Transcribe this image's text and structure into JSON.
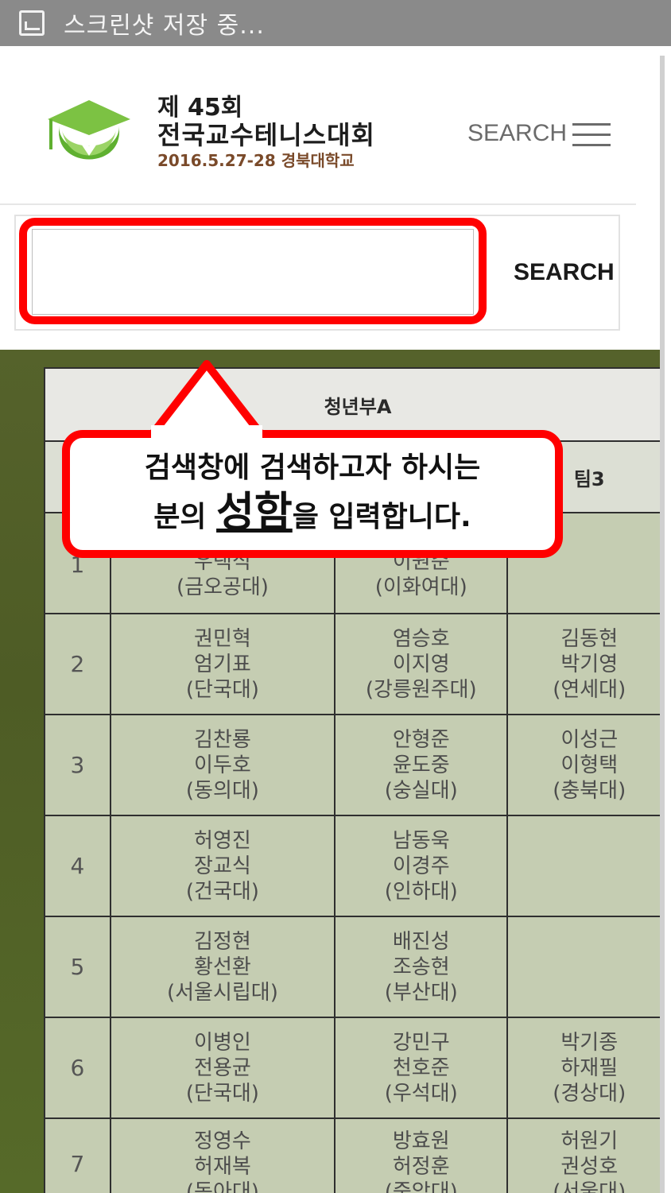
{
  "statusbar": {
    "title": "스크린샷 저장 중..."
  },
  "header": {
    "brand_line1": "제 45회",
    "brand_line2": "전국교수테니스대회",
    "brand_line3": "2016.5.27-28 경북대학교",
    "search_label": "SEARCH"
  },
  "search": {
    "value": "",
    "button_label": "SEARCH"
  },
  "callout": {
    "line1": "검색창에 검색하고자 하시는",
    "line2_pre": "분의 ",
    "line2_emph": "성함",
    "line2_post": "을 입력합니다."
  },
  "table": {
    "caption": "청년부A",
    "team3_header": "팀3",
    "rows": [
      {
        "num": "1",
        "t1": [
          "우택식",
          "(금오공대)"
        ],
        "t2": [
          "이원준",
          "(이화여대)"
        ],
        "t3": []
      },
      {
        "num": "2",
        "t1": [
          "권민혁",
          "엄기표",
          "(단국대)"
        ],
        "t2": [
          "염승호",
          "이지영",
          "(강릉원주대)"
        ],
        "t3": [
          "김동현",
          "박기영",
          "(연세대)"
        ]
      },
      {
        "num": "3",
        "t1": [
          "김찬룡",
          "이두호",
          "(동의대)"
        ],
        "t2": [
          "안형준",
          "윤도중",
          "(숭실대)"
        ],
        "t3": [
          "이성근",
          "이형택",
          "(충북대)"
        ]
      },
      {
        "num": "4",
        "t1": [
          "허영진",
          "장교식",
          "(건국대)"
        ],
        "t2": [
          "남동욱",
          "이경주",
          "(인하대)"
        ],
        "t3": []
      },
      {
        "num": "5",
        "t1": [
          "김정현",
          "황선환",
          "(서울시립대)"
        ],
        "t2": [
          "배진성",
          "조송현",
          "(부산대)"
        ],
        "t3": []
      },
      {
        "num": "6",
        "t1": [
          "이병인",
          "전용균",
          "(단국대)"
        ],
        "t2": [
          "강민구",
          "천호준",
          "(우석대)"
        ],
        "t3": [
          "박기종",
          "하재필",
          "(경상대)"
        ]
      },
      {
        "num": "7",
        "t1": [
          "정영수",
          "허재복",
          "(동아대)"
        ],
        "t2": [
          "방효원",
          "허정훈",
          "(중앙대)"
        ],
        "t3": [
          "허원기",
          "권성호",
          "(서울대)"
        ]
      }
    ]
  }
}
